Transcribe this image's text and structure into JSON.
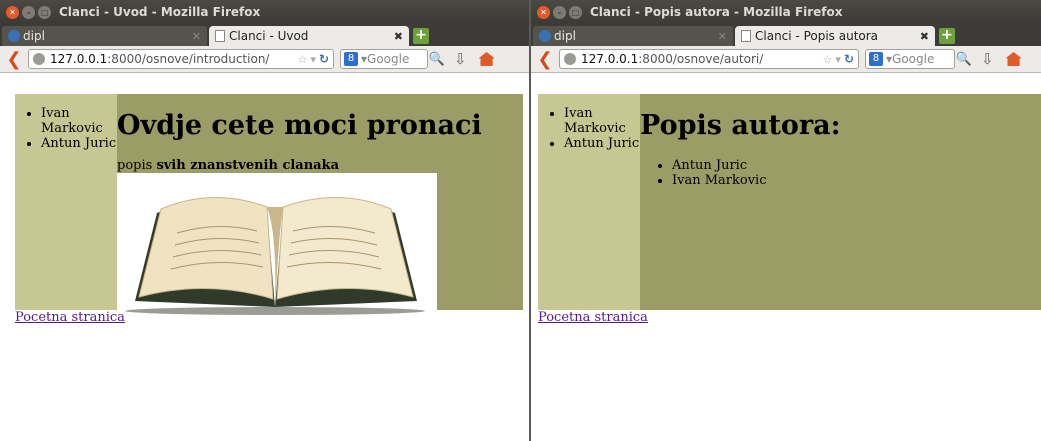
{
  "left_window": {
    "title": "Clanci - Uvod - Mozilla Firefox",
    "tabs": [
      {
        "label": "dipl"
      },
      {
        "label": "Clanci - Uvod"
      }
    ],
    "url_host": "127.0.0.1",
    "url_path": ":8000/osnove/introduction/",
    "search_placeholder": "Google",
    "sidebar_items": [
      "Ivan Markovic",
      "Antun Juric"
    ],
    "heading": "Ovdje cete moci pronaci",
    "subtitle_prefix": "popis ",
    "subtitle_bold": "svih znanstvenih clanaka",
    "link": "Pocetna stranica"
  },
  "right_window": {
    "title": "Clanci - Popis autora - Mozilla Firefox",
    "tabs": [
      {
        "label": "dipl"
      },
      {
        "label": "Clanci - Popis autora"
      }
    ],
    "url_host": "127.0.0.1",
    "url_path": ":8000/osnove/autori/",
    "search_placeholder": "Google",
    "sidebar_items": [
      "Ivan Markovic",
      "Antun Juric"
    ],
    "heading": "Popis autora:",
    "authors": [
      "Antun Juric",
      "Ivan Markovic"
    ],
    "link": "Pocetna stranica"
  },
  "colors": {
    "sidebar": "#c6c793",
    "main": "#9c9c66",
    "titlebar": "#3c3b37",
    "link": "#551a8b"
  }
}
